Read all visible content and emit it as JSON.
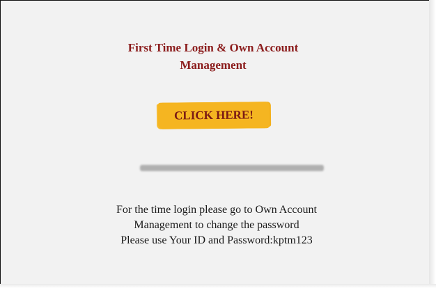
{
  "panel": {
    "title_line1": "First Time Login & Own Account",
    "title_line2": "Management",
    "button_label": "CLICK HERE!",
    "info_lines": [
      "For the time login please go to Own Account",
      "Management to change the password",
      "Please use Your ID and Password:kptm123"
    ]
  },
  "colors": {
    "title": "#8b1c1c",
    "button_bg": "#f5b521",
    "button_text": "#7a1a14",
    "panel_bg": "#f2f2f2"
  }
}
